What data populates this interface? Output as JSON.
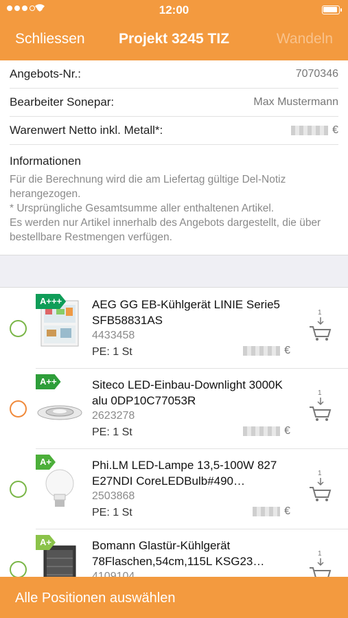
{
  "status_bar": {
    "time": "12:00"
  },
  "nav": {
    "close_label": "Schliessen",
    "title": "Projekt 3245 TIZ",
    "convert_label": "Wandeln"
  },
  "details": [
    {
      "label": "Angebots-Nr.:",
      "value": "7070346"
    },
    {
      "label": "Bearbeiter Sonepar:",
      "value": "Max Mustermann"
    },
    {
      "label": "Warenwert Netto inkl. Metall*:",
      "value": "€"
    }
  ],
  "info": {
    "title": "Informationen",
    "text": "Für die Berechnung wird die am Liefertag gültige Del-Notiz herangezogen.\n* Ursprüngliche Gesamtsumme aller enthaltenen Artikel.\nEs werden nur Artikel innerhalb des Angebots dargestellt, die über bestellbare Restmengen verfügen."
  },
  "items": [
    {
      "energy_label": "A+++",
      "energy_color": "#0f9d58",
      "radio_color": "green",
      "name": "AEG GG EB-Kühlgerät LINIE Serie5 SFB58831AS",
      "sku": "4433458",
      "pe": "PE: 1 St",
      "currency": "€",
      "cart_qty": "1",
      "icon": "fridge-image"
    },
    {
      "energy_label": "A++",
      "energy_color": "#2e9e3a",
      "radio_color": "orange",
      "name": "Siteco LED-Einbau-Downlight 3000K alu 0DP10C77053R",
      "sku": "2623278",
      "pe": "PE: 1 St",
      "currency": "€",
      "cart_qty": "1",
      "icon": "downlight-image"
    },
    {
      "energy_label": "A+",
      "energy_color": "#4caf3a",
      "radio_color": "green",
      "name": "Phi.LM LED-Lampe 13,5-100W 827 E27NDI CoreLEDBulb#490…",
      "sku": "2503868",
      "pe": "PE: 1 St",
      "currency": "€",
      "cart_qty": "1",
      "icon": "bulb-image"
    },
    {
      "energy_label": "A+",
      "energy_color": "#8bc34a",
      "radio_color": "green",
      "name": "Bomann Glastür-Kühlgerät 78Flaschen,54cm,115L KSG23…",
      "sku": "4109104",
      "pe": "",
      "currency": "",
      "cart_qty": "1",
      "icon": "wine-cooler-image"
    }
  ],
  "footer": {
    "select_all_label": "Alle Positionen auswählen"
  }
}
